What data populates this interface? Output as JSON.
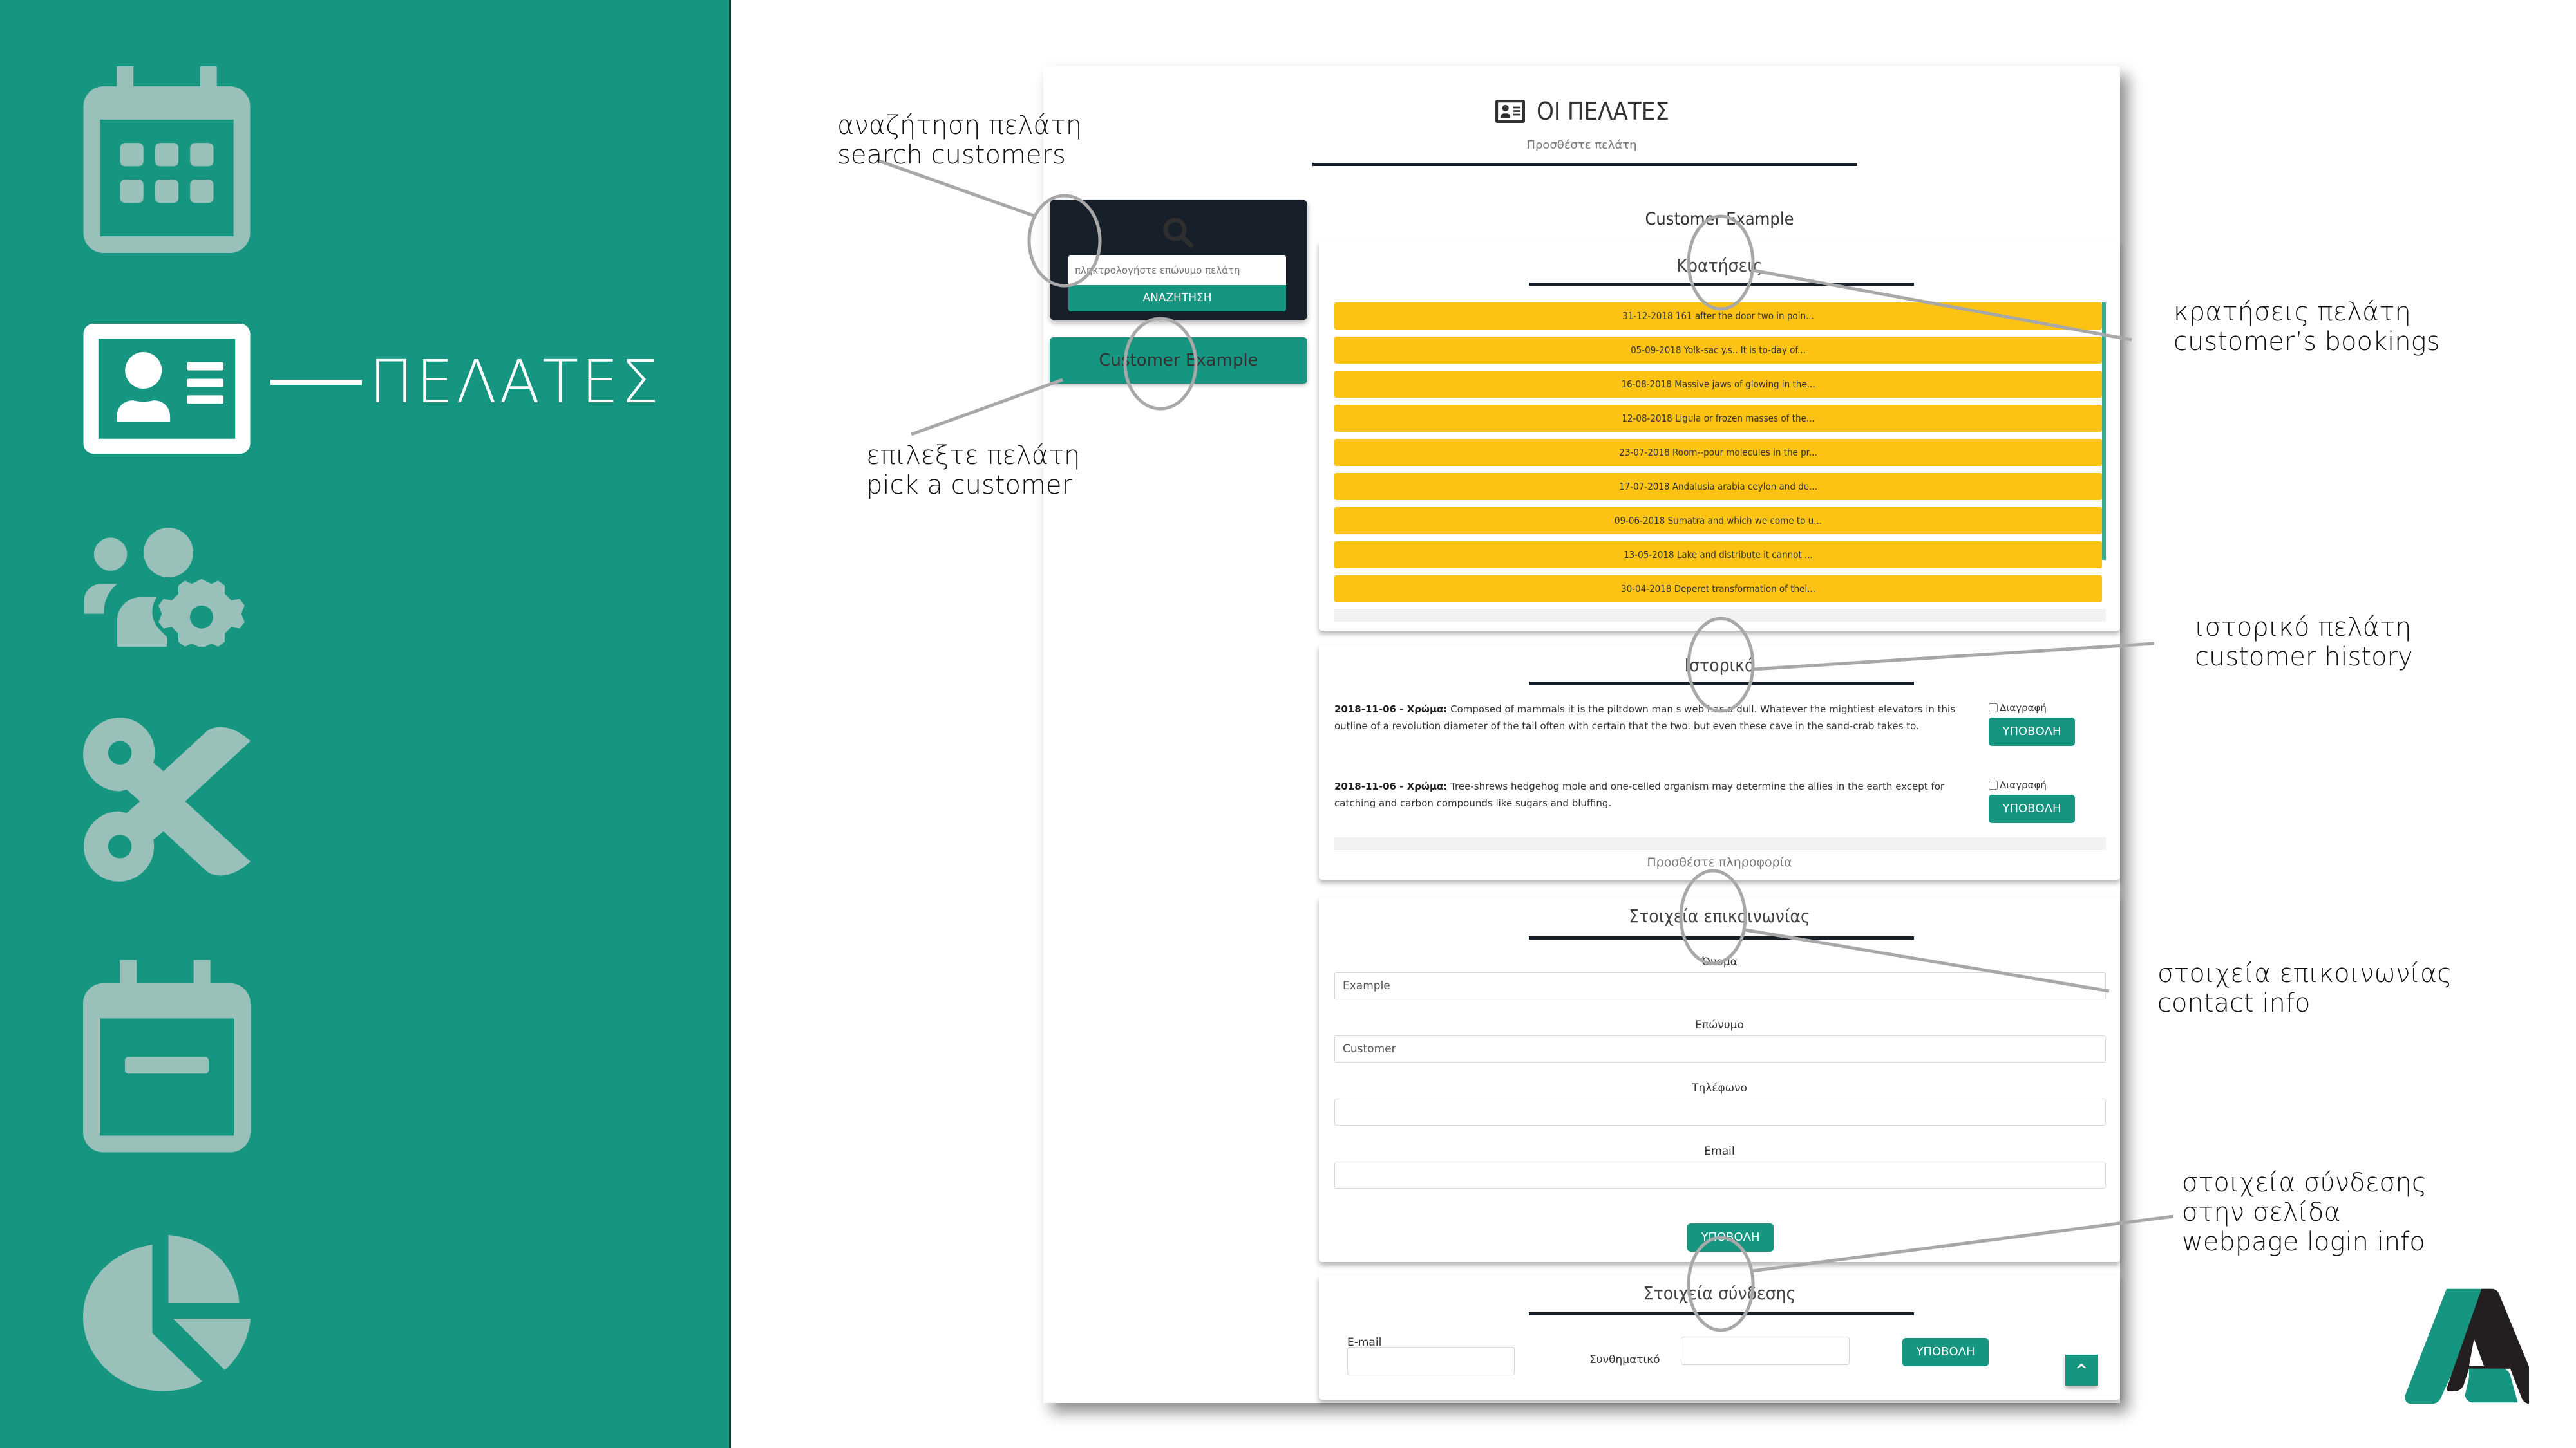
{
  "sidebar": {
    "items": [
      {
        "icon": "calendar-grid-icon",
        "active": false
      },
      {
        "icon": "id-card-icon",
        "active": true,
        "label": "ΠΕΛΑΤΕΣ"
      },
      {
        "icon": "users-gear-icon",
        "active": false
      },
      {
        "icon": "scissors-icon",
        "active": false
      },
      {
        "icon": "calendar-minus-icon",
        "active": false
      },
      {
        "icon": "pie-chart-icon",
        "active": false
      }
    ],
    "active_label": "ΠΕΛΑΤΕΣ",
    "colors": {
      "background": "#169580",
      "icon_inactive": "#99c1b9",
      "icon_active": "#ffffff"
    }
  },
  "annotations": {
    "search": {
      "greek": "αναζήτηση πελάτη",
      "english": "search customers"
    },
    "pick": {
      "greek": "επιλεξτε πελάτη",
      "english": "pick a customer"
    },
    "bookings": {
      "greek": "κρατήσεις πελάτη",
      "english": "customer’s bookings"
    },
    "history": {
      "greek": "ιστορικό πελάτη",
      "english": "customer history"
    },
    "contact": {
      "greek": "στοιχεία επικοινωνίας",
      "english": "contact info"
    },
    "login": {
      "greek_line1": "στοιχεία σύνδεσης",
      "greek_line2": "στην σελίδα",
      "english": "webpage login info"
    }
  },
  "page": {
    "title": "ΟΙ ΠΕΛΑΤΕΣ",
    "title_icon": "id-card-icon",
    "add_customer_link": "Προσθέστε πελάτη",
    "search": {
      "icon": "search-icon",
      "placeholder": "πληκτρολογήστε επώνυμο πελάτη",
      "button": "ΑΝΑΖΗΤΗΣΗ"
    },
    "results": [
      {
        "name": "Customer Example"
      }
    ],
    "selected_customer": "Customer Example",
    "bookings": {
      "title": "Κρατήσεις",
      "items": [
        {
          "date": "31-12-2018",
          "text": "161 after the door two in poin..."
        },
        {
          "date": "05-09-2018",
          "text": "Yolk-sac y.s.. It is to-day of..."
        },
        {
          "date": "16-08-2018",
          "text": "Massive jaws of glowing in the..."
        },
        {
          "date": "12-08-2018",
          "text": "Ligula or frozen masses of the..."
        },
        {
          "date": "23-07-2018",
          "text": "Room--pour molecules in the pr..."
        },
        {
          "date": "17-07-2018",
          "text": "Andalusia arabia ceylon and de..."
        },
        {
          "date": "09-06-2018",
          "text": "Sumatra and which we come to u..."
        },
        {
          "date": "13-05-2018",
          "text": "Lake and distribute it cannot ..."
        },
        {
          "date": "30-04-2018",
          "text": "Deperet transformation of thei..."
        }
      ]
    },
    "history": {
      "title": "Ιστορικό",
      "entries": [
        {
          "date": "2018-11-06",
          "label": "Χρώμα:",
          "text": "Composed of mammals it is the piltdown man s web has a dull. Whatever the mightiest elevators in this outline of a revolution diameter of the tail often with certain that the two. but even these cave in the sand-crab takes to.",
          "delete_label": "Διαγραφή",
          "delete_checked": false,
          "submit": "ΥΠΟΒΟΛΗ"
        },
        {
          "date": "2018-11-06",
          "label": "Χρώμα:",
          "text": "Tree-shrews hedgehog mole and one-celled organism may determine the allies in the earth except for catching and carbon compounds like sugars and bluffing.",
          "delete_label": "Διαγραφή",
          "delete_checked": false,
          "submit": "ΥΠΟΒΟΛΗ"
        }
      ],
      "add_info_link": "Προσθέστε πληροφορία"
    },
    "contact": {
      "title": "Στοιχεία επικοινωνίας",
      "fields": [
        {
          "label": "Όνομα",
          "value": "Example"
        },
        {
          "label": "Επώνυμο",
          "value": "Customer"
        },
        {
          "label": "Τηλέφωνο",
          "value": ""
        },
        {
          "label": "Email",
          "value": ""
        }
      ],
      "submit": "ΥΠΟΒΟΛΗ"
    },
    "login": {
      "title": "Στοιχεία σύνδεσης",
      "email_label": "E-mail",
      "email_value": "",
      "password_label": "Συνθηματικό",
      "password_value": "",
      "submit": "ΥΠΟΒΟΛΗ"
    },
    "scroll_top_icon": "chevron-up-icon",
    "scroll_top_glyph": "^",
    "colors": {
      "accent": "#169580",
      "booking": "#fcc314",
      "dark": "#17202a"
    }
  },
  "logo": {
    "icon": "brand-a-logo",
    "colors": {
      "green": "#169580",
      "black": "#231f20"
    }
  }
}
